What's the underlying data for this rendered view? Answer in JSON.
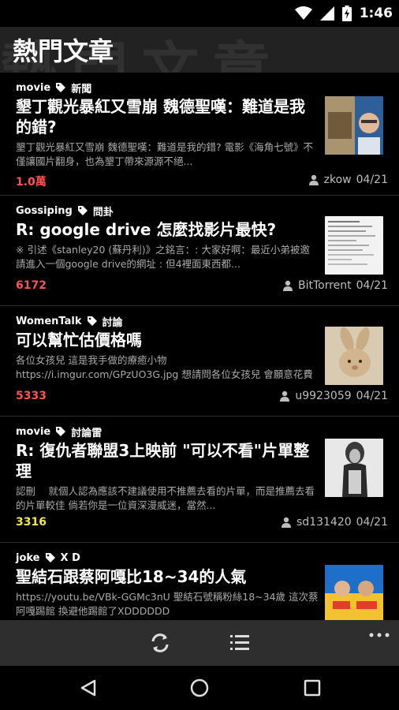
{
  "status_bar": {
    "time": "1:46"
  },
  "app_bar": {
    "title": "熱門文章",
    "watermark": "熱門文章"
  },
  "posts": [
    {
      "board": "movie",
      "category": "新聞",
      "title": "墾丁觀光暴紅又雪崩 魏德聖嘆：難道是我的錯?",
      "excerpt": "墾丁觀光暴紅又雪崩 魏德聖嘆：難道是我的錯? 電影《海角七號》不僅讓國片翻身，也為墾丁帶來源源不絕...",
      "count": "1.0萬",
      "count_color": "#ff5252",
      "author": "zkow",
      "date": "04/21"
    },
    {
      "board": "Gossiping",
      "category": "問卦",
      "title": "R: google drive 怎麼找影片最快?",
      "excerpt": "※ 引述《stanley20 (蘇丹利)》之銘言：: 大家好啊：最近小弟被邀請進入一個google drive的網址 : 但4裡面東西都...",
      "count": "6172",
      "count_color": "#ff5252",
      "author": "BitTorrent",
      "date": "04/21"
    },
    {
      "board": "WomenTalk",
      "category": "討論",
      "title": "可以幫忙估價格嗎",
      "excerpt": "各位女孩兒 這是我手做的療癒小物 https://i.imgur.com/GPzUO3G.jpg 想請問各位女孩兒 會願意花費多少錢買這...",
      "count": "5333",
      "count_color": "#ff5252",
      "author": "u9923059",
      "date": "04/21"
    },
    {
      "board": "movie",
      "category": "討論雷",
      "title": "R: 復仇者聯盟3上映前 \"可以不看\"片單整理",
      "excerpt": "認刪　 就個人認為應該不建議使用不推薦去看的片單，而是推薦去看的片單較佳 倘若你是一位資深漫威迷，當然...",
      "count": "3316",
      "count_color": "#f2e64a",
      "author": "sd131420",
      "date": "04/21"
    },
    {
      "board": "joke",
      "category": "X D",
      "title": "聖結石跟蔡阿嘎比18~34的人氣",
      "excerpt": "https://youtu.be/VBk-GGMc3nU 聖結石號稱粉絲18~34歲 這次蔡阿嘎踢館 換避他踢館了XDDDDDD",
      "count": "",
      "count_color": "#ff5252",
      "author": "",
      "date": ""
    }
  ],
  "icons": {
    "wifi": "wifi-icon",
    "signal": "signal-icon",
    "battery": "battery-icon",
    "tag": "tag-icon",
    "user": "user-icon",
    "refresh": "refresh-icon",
    "list": "list-icon",
    "more": "more-icon",
    "back": "back-icon",
    "home": "home-icon",
    "recents": "recents-icon"
  },
  "colors": {
    "app_bar": "#222222",
    "toolbar": "#2e2e2e",
    "count_hot": "#ff5252",
    "count_warm": "#f2e64a"
  }
}
